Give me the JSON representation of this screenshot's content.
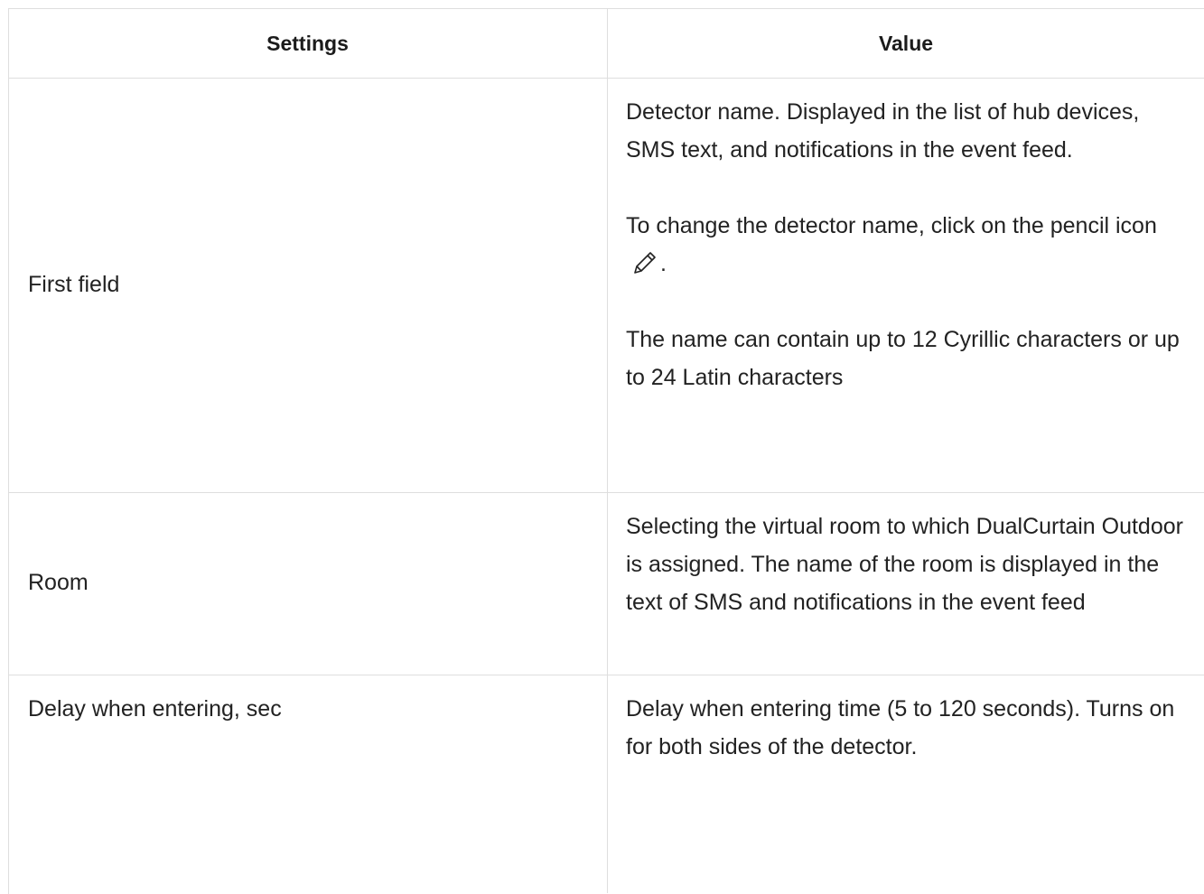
{
  "table": {
    "headers": {
      "settings": "Settings",
      "value": "Value"
    },
    "rows": [
      {
        "setting": "First field",
        "value_p1": "Detector name. Displayed in the list of hub devices, SMS text, and notifications in the event feed.",
        "value_p2_before_icon": "To change the detector name, click on the pencil icon",
        "value_p2_after_icon": ".",
        "value_p3": "The name can contain up to 12 Cyrillic characters or up to 24 Latin characters"
      },
      {
        "setting": "Room",
        "value_p1": "Selecting the virtual room to which DualCurtain Outdoor is assigned. The name of the room is displayed in the text of SMS and notifications in the event feed"
      },
      {
        "setting": "Delay when entering, sec",
        "value_p1": "Delay when entering time (5 to 120 seconds). Turns on for both sides of the detector."
      }
    ],
    "icons": {
      "pencil": "pencil-icon"
    }
  }
}
